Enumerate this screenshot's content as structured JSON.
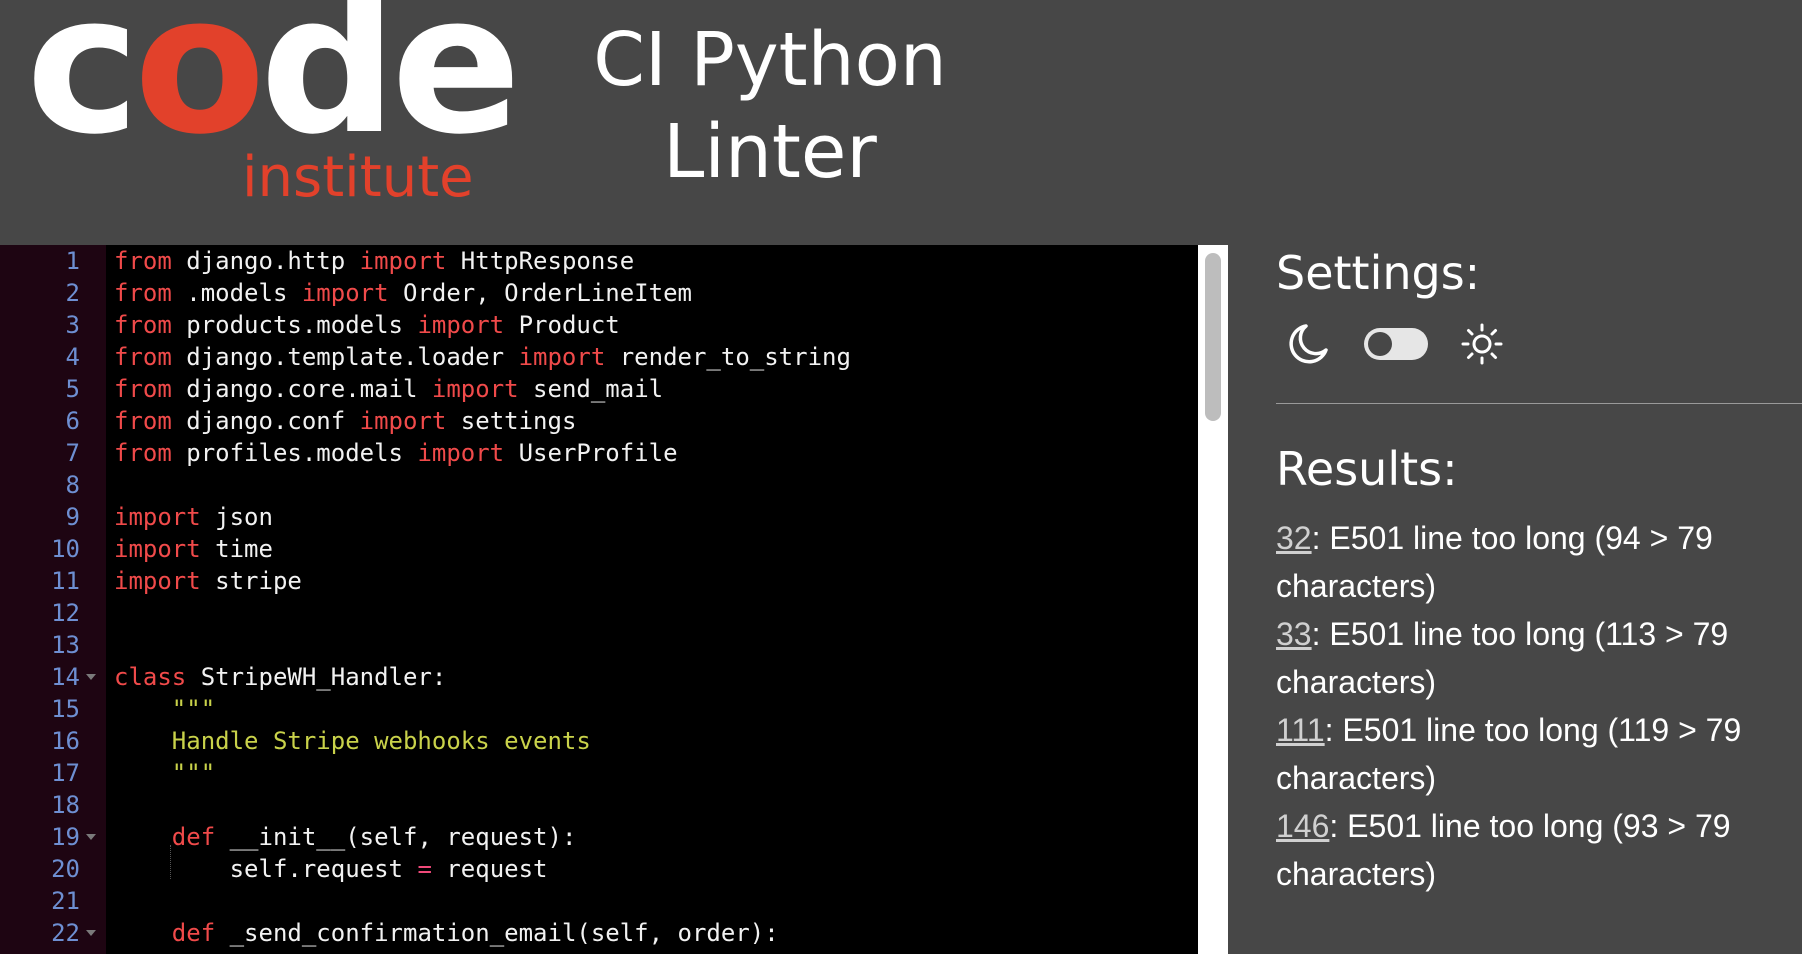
{
  "header": {
    "logo_word_parts": [
      "c",
      "o",
      "de"
    ],
    "logo_sub": "institute",
    "title_line1": "CI Python",
    "title_line2": "Linter"
  },
  "colors": {
    "background": "#474747",
    "brand_red": "#e2412b",
    "editor_bg": "#000000",
    "keyword": "#f04a4a",
    "string": "#c9d24a",
    "line_number": "#6e8fd2"
  },
  "editor": {
    "lines": [
      {
        "n": "1",
        "tokens": [
          [
            "kw",
            "from"
          ],
          [
            "plain",
            " django.http "
          ],
          [
            "kw",
            "import"
          ],
          [
            "plain",
            " HttpResponse"
          ]
        ]
      },
      {
        "n": "2",
        "tokens": [
          [
            "kw",
            "from"
          ],
          [
            "plain",
            " .models "
          ],
          [
            "kw",
            "import"
          ],
          [
            "plain",
            " Order, OrderLineItem"
          ]
        ]
      },
      {
        "n": "3",
        "tokens": [
          [
            "kw",
            "from"
          ],
          [
            "plain",
            " products.models "
          ],
          [
            "kw",
            "import"
          ],
          [
            "plain",
            " Product"
          ]
        ]
      },
      {
        "n": "4",
        "tokens": [
          [
            "kw",
            "from"
          ],
          [
            "plain",
            " django.template.loader "
          ],
          [
            "kw",
            "import"
          ],
          [
            "plain",
            " render_to_string"
          ]
        ]
      },
      {
        "n": "5",
        "tokens": [
          [
            "kw",
            "from"
          ],
          [
            "plain",
            " django.core.mail "
          ],
          [
            "kw",
            "import"
          ],
          [
            "plain",
            " send_mail"
          ]
        ]
      },
      {
        "n": "6",
        "tokens": [
          [
            "kw",
            "from"
          ],
          [
            "plain",
            " django.conf "
          ],
          [
            "kw",
            "import"
          ],
          [
            "plain",
            " settings"
          ]
        ]
      },
      {
        "n": "7",
        "tokens": [
          [
            "kw",
            "from"
          ],
          [
            "plain",
            " profiles.models "
          ],
          [
            "kw",
            "import"
          ],
          [
            "plain",
            " UserProfile"
          ]
        ]
      },
      {
        "n": "8",
        "tokens": []
      },
      {
        "n": "9",
        "tokens": [
          [
            "kw",
            "import"
          ],
          [
            "plain",
            " json"
          ]
        ]
      },
      {
        "n": "10",
        "tokens": [
          [
            "kw",
            "import"
          ],
          [
            "plain",
            " time"
          ]
        ]
      },
      {
        "n": "11",
        "tokens": [
          [
            "kw",
            "import"
          ],
          [
            "plain",
            " stripe"
          ]
        ]
      },
      {
        "n": "12",
        "tokens": []
      },
      {
        "n": "13",
        "tokens": []
      },
      {
        "n": "14",
        "fold": true,
        "tokens": [
          [
            "kw",
            "class"
          ],
          [
            "plain",
            " StripeWH_Handler:"
          ]
        ]
      },
      {
        "n": "15",
        "tokens": [
          [
            "plain",
            "    "
          ],
          [
            "str",
            "\"\"\""
          ]
        ]
      },
      {
        "n": "16",
        "tokens": [
          [
            "plain",
            "    "
          ],
          [
            "str",
            "Handle Stripe webhooks events"
          ]
        ]
      },
      {
        "n": "17",
        "tokens": [
          [
            "plain",
            "    "
          ],
          [
            "str",
            "\"\"\""
          ]
        ]
      },
      {
        "n": "18",
        "tokens": []
      },
      {
        "n": "19",
        "fold": true,
        "tokens": [
          [
            "plain",
            "    "
          ],
          [
            "kw",
            "def"
          ],
          [
            "plain",
            " __init__(self, request):"
          ]
        ]
      },
      {
        "n": "20",
        "guide": true,
        "tokens": [
          [
            "plain",
            "        self.request "
          ],
          [
            "op",
            "="
          ],
          [
            "plain",
            " request"
          ]
        ]
      },
      {
        "n": "21",
        "tokens": []
      },
      {
        "n": "22",
        "fold": true,
        "tokens": [
          [
            "plain",
            "    "
          ],
          [
            "kw",
            "def"
          ],
          [
            "plain",
            " _send_confirmation_email(self, order):"
          ]
        ]
      }
    ]
  },
  "settings": {
    "title": "Settings:",
    "moon_icon": "moon-icon",
    "sun_icon": "sun-icon",
    "theme_toggle_on": false
  },
  "results": {
    "title": "Results:",
    "items": [
      {
        "line": "32",
        "message": ": E501 line too long (94 > 79 characters)"
      },
      {
        "line": "33",
        "message": ": E501 line too long (113 > 79 characters)"
      },
      {
        "line": "111",
        "message": ": E501 line too long (119 > 79 characters)"
      },
      {
        "line": "146",
        "message": ": E501 line too long (93 > 79 characters)"
      }
    ]
  }
}
